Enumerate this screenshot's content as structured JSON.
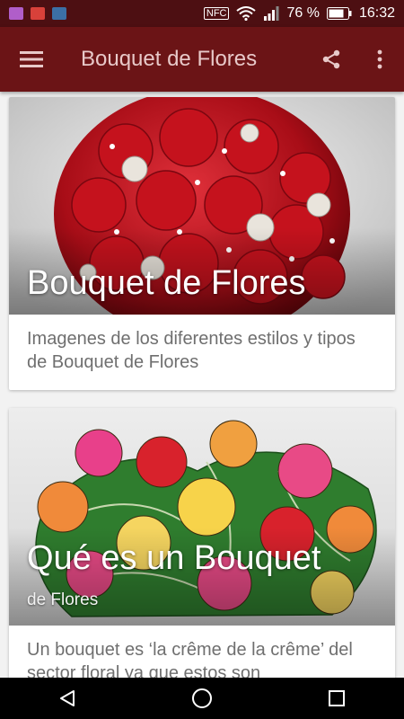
{
  "status_bar": {
    "nfc": "NFC",
    "battery": "76 %",
    "time": "16:32"
  },
  "app_bar": {
    "title": "Bouquet de Flores"
  },
  "cards": [
    {
      "title": "Bouquet de Flores",
      "subtitle": "",
      "description": "Imagenes de los diferentes estilos y tipos de Bouquet de Flores"
    },
    {
      "title": "Qué es un Bouquet",
      "subtitle": "de Flores",
      "description": "Un bouquet es ‘la crême de la crême’ del sector floral ya que estos son"
    }
  ],
  "colors": {
    "status_bar": "#4d0f12",
    "app_bar": "#6b1416",
    "app_bar_text": "#e8c9c9"
  },
  "icons": [
    "menu-icon",
    "share-icon",
    "more-vert-icon",
    "back-icon",
    "home-icon",
    "recents-icon"
  ]
}
